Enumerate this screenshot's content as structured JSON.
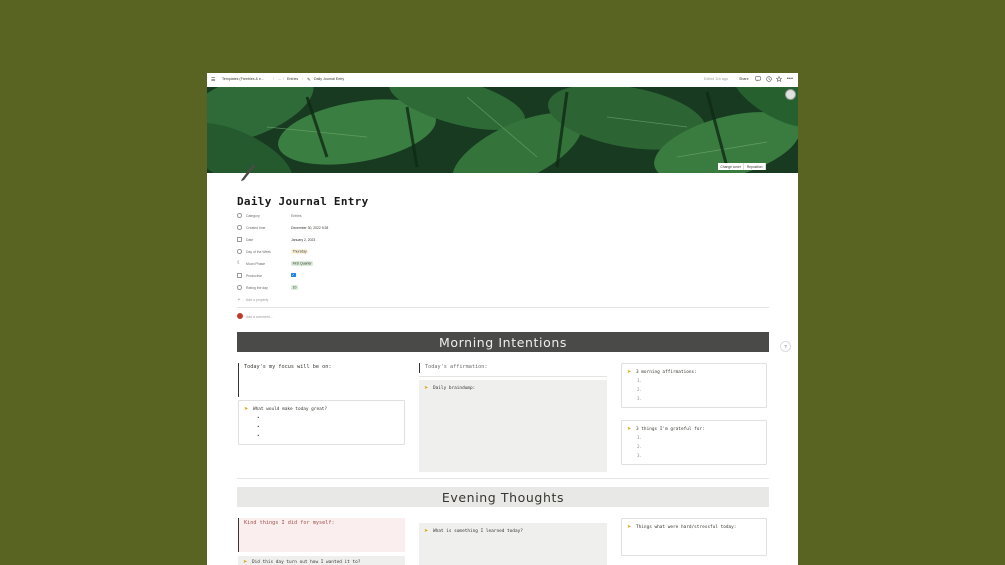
{
  "topbar": {
    "breadcrumb_1": "Templates (Freebies & e...",
    "breadcrumb_sep_1": "/",
    "breadcrumb_ellipsis": "...",
    "breadcrumb_sep_2": "/",
    "breadcrumb_2": "Entries",
    "breadcrumb_sep_3": "/",
    "breadcrumb_3": "Daily Journal Entry",
    "edited": "Edited 11h ago",
    "share": "Share"
  },
  "cover": {
    "change_cover": "Change cover",
    "reposition": "Reposition"
  },
  "page": {
    "title": "Daily Journal Entry"
  },
  "properties": [
    {
      "name": "Category",
      "value": "Entries",
      "icon": "tag-icon"
    },
    {
      "name": "Created time",
      "value": "December 30, 2022 9:28",
      "icon": "clock-icon"
    },
    {
      "name": "Date",
      "value": "January 2, 2023",
      "icon": "calendar-icon"
    },
    {
      "name": "Day of the Week",
      "value": "Thursday",
      "icon": "select-icon",
      "tag_color": "#fbf3db"
    },
    {
      "name": "Moon Phase",
      "value": "First Quarter",
      "icon": "moon-icon",
      "tag_color": "#dbeddb"
    },
    {
      "name": "Productive",
      "value": "✓",
      "icon": "checkbox-icon"
    },
    {
      "name": "Rating the day",
      "value": "10",
      "icon": "select-icon",
      "tag_color": "#dbeddb"
    }
  ],
  "add_property": "Add a property",
  "add_comment": "Add a comment...",
  "help": "?",
  "morning": {
    "heading": "Morning Intentions",
    "focus": "Today's my focus will be on:",
    "affirmation": "Today's affirmation:",
    "great": "What would make today great?",
    "great_bullets": [
      "•",
      "•",
      "•"
    ],
    "braindump": "Daily braindump:",
    "affirmations": "3 morning affirmations:",
    "affirmations_items": [
      "1.",
      "2.",
      "3."
    ],
    "grateful": "3 things I'm grateful for:",
    "grateful_items": [
      "1.",
      "2.",
      "3."
    ]
  },
  "evening": {
    "heading": "Evening Thoughts",
    "kind": "Kind things I did for myself:",
    "learned": "What is something I learned today?",
    "hard": "Things what were hard/stressful today:",
    "turned_out": "Did this day turn out how I wanted it to?"
  },
  "colors": {
    "background": "#5a6422",
    "morning_banner": "#4a4a48",
    "evening_banner": "#e8e8e6",
    "kind_box": "#fbeeee",
    "grey_box": "#efefed",
    "callout_icon": "#d9a300"
  }
}
